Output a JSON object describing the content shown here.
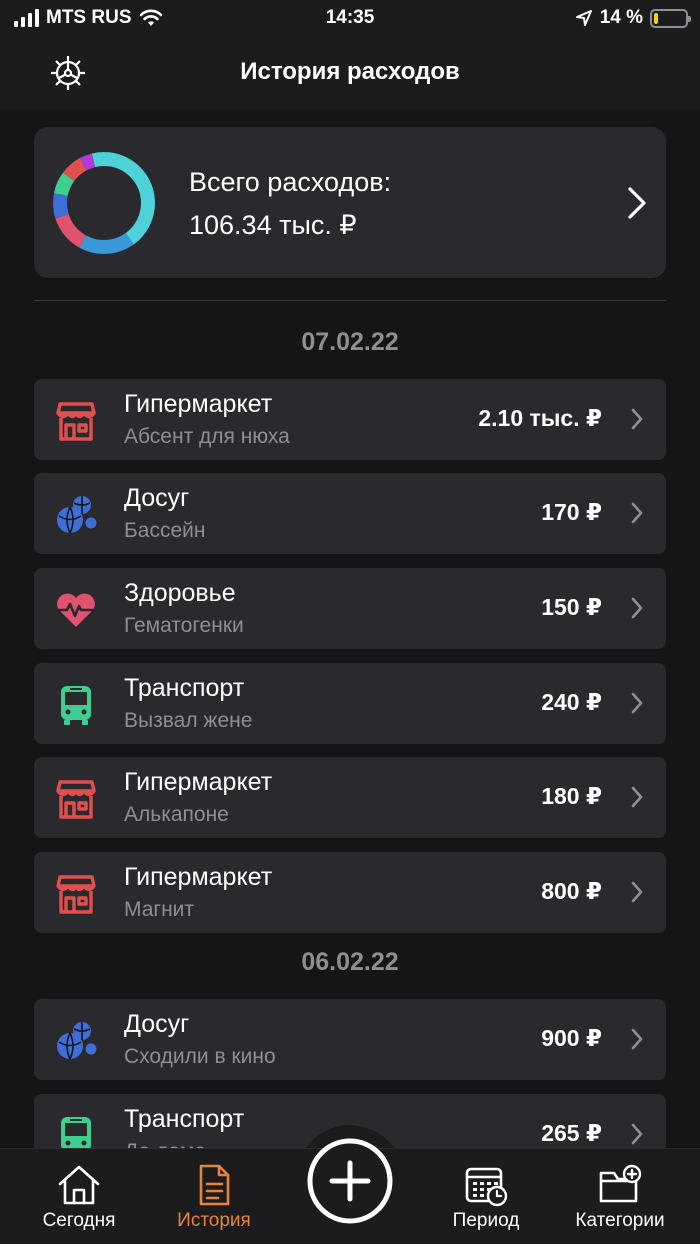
{
  "status_bar": {
    "carrier": "MTS RUS",
    "time": "14:35",
    "battery_percent": "14 %",
    "battery_level": 0.14
  },
  "header": {
    "title": "История расходов"
  },
  "summary": {
    "label": "Всего расходов:",
    "value": "106.34 тыс. ₽"
  },
  "sections": [
    {
      "date": "07.02.22",
      "items": [
        {
          "category": "Гипермаркет",
          "note": "Абсент для нюха",
          "amount": "2.10 тыс. ₽",
          "icon": "store-icon",
          "color": "#e0514e"
        },
        {
          "category": "Досуг",
          "note": "Бассейн",
          "amount": "170 ₽",
          "icon": "balls-icon",
          "color": "#3f6fd6"
        },
        {
          "category": "Здоровье",
          "note": "Гематогенки",
          "amount": "150 ₽",
          "icon": "heart-pulse-icon",
          "color": "#e0536f"
        },
        {
          "category": "Транспорт",
          "note": "Вызвал жене",
          "amount": "240 ₽",
          "icon": "bus-icon",
          "color": "#3ecf8e"
        },
        {
          "category": "Гипермаркет",
          "note": "Алькапоне",
          "amount": "180 ₽",
          "icon": "store-icon",
          "color": "#e0514e"
        },
        {
          "category": "Гипермаркет",
          "note": "Магнит",
          "amount": "800 ₽",
          "icon": "store-icon",
          "color": "#e0514e"
        }
      ]
    },
    {
      "date": "06.02.22",
      "items": [
        {
          "category": "Досуг",
          "note": "Сходили в кино",
          "amount": "900 ₽",
          "icon": "balls-icon",
          "color": "#3f6fd6"
        },
        {
          "category": "Транспорт",
          "note": "До дома",
          "amount": "265 ₽",
          "icon": "bus-icon",
          "color": "#3ecf8e"
        }
      ]
    }
  ],
  "tabs": [
    {
      "label": "Сегодня",
      "icon": "home-icon",
      "active": false
    },
    {
      "label": "История",
      "icon": "document-icon",
      "active": true
    },
    {
      "label": "",
      "icon": "plus-circle-icon",
      "active": false
    },
    {
      "label": "Период",
      "icon": "calendar-clock-icon",
      "active": false
    },
    {
      "label": "Категории",
      "icon": "folder-plus-icon",
      "active": false
    }
  ],
  "colors": {
    "accent": "#e8833a",
    "background": "#151518",
    "card": "#2a2a2e",
    "muted_text": "#8e8e93"
  },
  "donut_segments": [
    {
      "color": "#4fd1d9",
      "share": 0.4
    },
    {
      "color": "#3a9ad9",
      "share": 0.18
    },
    {
      "color": "#e0536f",
      "share": 0.12
    },
    {
      "color": "#3f6fd6",
      "share": 0.08
    },
    {
      "color": "#3ecf8e",
      "share": 0.07
    },
    {
      "color": "#e0514e",
      "share": 0.07
    },
    {
      "color": "#b03ad9",
      "share": 0.04
    },
    {
      "color": "#4fd1d9",
      "share": 0.04
    }
  ]
}
